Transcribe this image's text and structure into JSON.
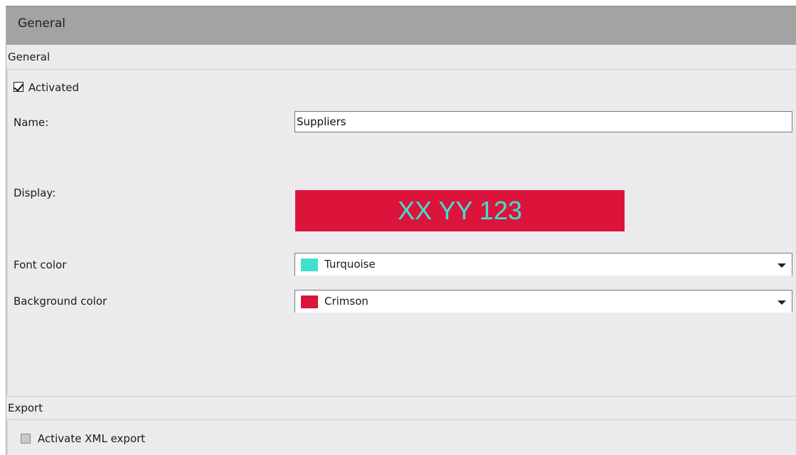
{
  "title_bar": {
    "title": "General"
  },
  "general_section": {
    "header": "General",
    "activated": {
      "label": "Activated",
      "checked": true
    },
    "name": {
      "label": "Name:",
      "value": "Suppliers"
    },
    "display": {
      "label": "Display:",
      "preview_text": "XX YY 123"
    },
    "font_color": {
      "label": "Font color",
      "value": "Turquoise",
      "swatch": "#40E0D0"
    },
    "background_color": {
      "label": "Background color",
      "value": "Crimson",
      "swatch": "#DC143C"
    }
  },
  "export_section": {
    "header": "Export",
    "xml_export": {
      "label": "Activate XML export",
      "checked": false
    }
  },
  "icons": {
    "dropdown": "chevron-down-icon",
    "check": "checkmark-icon"
  }
}
